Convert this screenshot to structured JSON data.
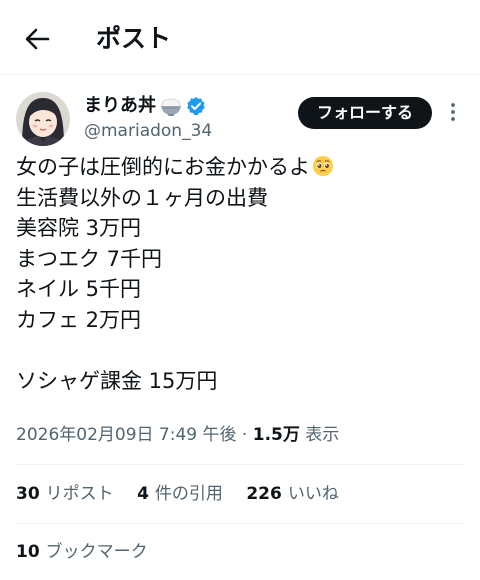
{
  "header": {
    "title": "ポスト",
    "back_icon": "arrow-left-icon"
  },
  "author": {
    "name": "まりあ丼",
    "name_emoji": "rice-bowl-icon",
    "verified_icon": "verified-badge-icon",
    "verified_color": "#1d9bf0",
    "handle": "@mariadon_34"
  },
  "follow_label": "フォローする",
  "post": {
    "lines": [
      "女の子は圧倒的にお金かかるよ",
      "生活費以外の１ヶ月の出費",
      "美容院 3万円",
      "まつエク 7千円",
      "ネイル 5千円",
      "カフェ 2万円",
      "",
      "ソシャゲ課金 15万円"
    ],
    "line1_emoji": "pleading-face-icon"
  },
  "meta": {
    "timestamp": "2026年02月09日 7:49 午後",
    "separator": "·",
    "views_count": "1.5万",
    "views_label": "表示"
  },
  "stats": {
    "reposts_count": "30",
    "reposts_label": "リポスト",
    "quotes_count": "4",
    "quotes_label": "件の引用",
    "likes_count": "226",
    "likes_label": "いいね",
    "bookmarks_count": "10",
    "bookmarks_label": "ブックマーク"
  },
  "colors": {
    "text": "#0f1419",
    "secondary": "#536471",
    "divider": "#eff3f4",
    "button": "#0f1419"
  }
}
